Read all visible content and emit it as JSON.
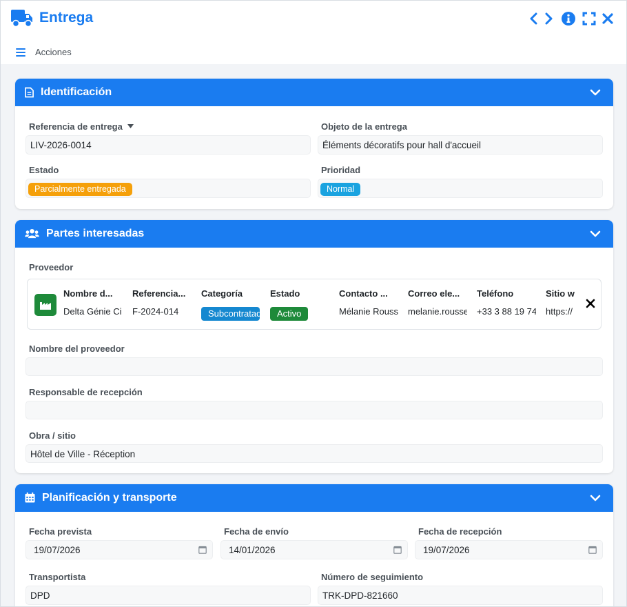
{
  "window": {
    "title": "Entrega",
    "actions_label": "Acciones"
  },
  "identificacion": {
    "title": "Identificación",
    "referencia_label": "Referencia de entrega",
    "referencia_value": "LIV-2026-0014",
    "objeto_label": "Objeto de la entrega",
    "objeto_value": "Éléments décoratifs pour hall d'accueil",
    "estado_label": "Estado",
    "estado_value": "Parcialmente entregada",
    "prioridad_label": "Prioridad",
    "prioridad_value": "Normal"
  },
  "partes": {
    "title": "Partes interesadas",
    "proveedor_label": "Proveedor",
    "supplier_headers": [
      "Nombre d...",
      "Referencia...",
      "Categoría",
      "Estado",
      "Contacto ...",
      "Correo ele...",
      "Teléfono",
      "Sitio w"
    ],
    "supplier": {
      "nombre": "Delta Génie Ci",
      "referencia": "F-2024-014",
      "categoria": "Subcontratad",
      "estado": "Activo",
      "contacto": "Mélanie Rouss",
      "correo": "melanie.rousse",
      "telefono": "+33 3 88 19 74",
      "sitio": "https://"
    },
    "nombre_proveedor_label": "Nombre del proveedor",
    "nombre_proveedor_value": "",
    "responsable_label": "Responsable de recepción",
    "responsable_value": "",
    "obra_label": "Obra / sitio",
    "obra_value": "Hôtel de Ville - Réception"
  },
  "planificacion": {
    "title": "Planificación y transporte",
    "fecha_prevista_label": "Fecha prevista",
    "fecha_prevista_value": "19/07/2026",
    "fecha_envio_label": "Fecha de envío",
    "fecha_envio_value": "14/01/2026",
    "fecha_recepcion_label": "Fecha de recepción",
    "fecha_recepcion_value": "19/07/2026",
    "transportista_label": "Transportista",
    "transportista_value": "DPD",
    "seguimiento_label": "Número de seguimiento",
    "seguimiento_value": "TRK-DPD-821660"
  },
  "colors": {
    "accent": "#1a7cf0",
    "estado_badge": "#f5a00a",
    "prioridad_badge": "#1aa3e0",
    "categoria_badge": "#1588d0",
    "activo_badge": "#1e8a3a"
  }
}
